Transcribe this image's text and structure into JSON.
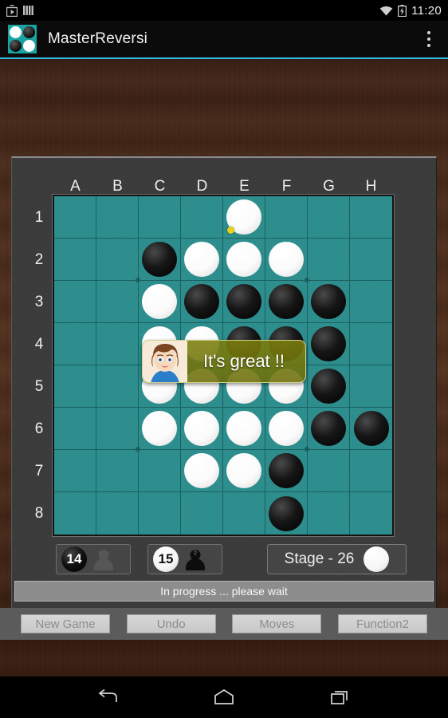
{
  "status_bar": {
    "icons_left": [
      "play-store-icon",
      "bars-icon"
    ],
    "wifi_icon": "wifi-icon",
    "battery_icon": "battery-charging-icon",
    "time": "11:20"
  },
  "action_bar": {
    "app_icon": "reversi-logo-icon",
    "title": "MasterReversi",
    "overflow_icon": "overflow-menu-icon"
  },
  "board": {
    "column_labels": [
      "A",
      "B",
      "C",
      "D",
      "E",
      "F",
      "G",
      "H"
    ],
    "row_labels": [
      "1",
      "2",
      "3",
      "4",
      "5",
      "6",
      "7",
      "8"
    ],
    "teal": "#2d8f8f",
    "cells": [
      [
        "",
        "",
        "",
        "",
        "W",
        "",
        "",
        ""
      ],
      [
        "",
        "",
        "B",
        "W",
        "W",
        "W",
        "",
        ""
      ],
      [
        "",
        "",
        "W",
        "B",
        "B",
        "B",
        "B",
        ""
      ],
      [
        "",
        "",
        "W",
        "W",
        "B",
        "B",
        "B",
        ""
      ],
      [
        "",
        "",
        "W",
        "W",
        "W",
        "W",
        "B",
        ""
      ],
      [
        "",
        "",
        "W",
        "W",
        "W",
        "W",
        "B",
        "B"
      ],
      [
        "",
        "",
        "",
        "W",
        "W",
        "B",
        "",
        ""
      ],
      [
        "",
        "",
        "",
        "",
        "",
        "B",
        "",
        ""
      ]
    ],
    "last_move": {
      "row": 0,
      "col": 4
    },
    "star_points": [
      {
        "row": 1,
        "col": 1
      },
      {
        "row": 1,
        "col": 5
      },
      {
        "row": 5,
        "col": 1
      },
      {
        "row": 5,
        "col": 5
      }
    ]
  },
  "speech_bubble": {
    "text": "It's great !!",
    "avatar": "female-avatar-icon"
  },
  "scores": {
    "black_label": "14",
    "black_player_icon": "cpu-player-icon",
    "white_label": "15",
    "white_player_icon": "human-player-icon",
    "stage_label": "Stage - 26",
    "turn_disc": "white-turn-disc-icon"
  },
  "status_message": "In progress ... please wait",
  "buttons": [
    {
      "label": "New Game",
      "name": "new-game-button"
    },
    {
      "label": "Undo",
      "name": "undo-button"
    },
    {
      "label": "Moves",
      "name": "moves-button"
    },
    {
      "label": "Function2",
      "name": "function2-button"
    }
  ],
  "nav_bar": {
    "back_icon": "back-icon",
    "home_icon": "home-icon",
    "recents_icon": "recents-icon"
  }
}
